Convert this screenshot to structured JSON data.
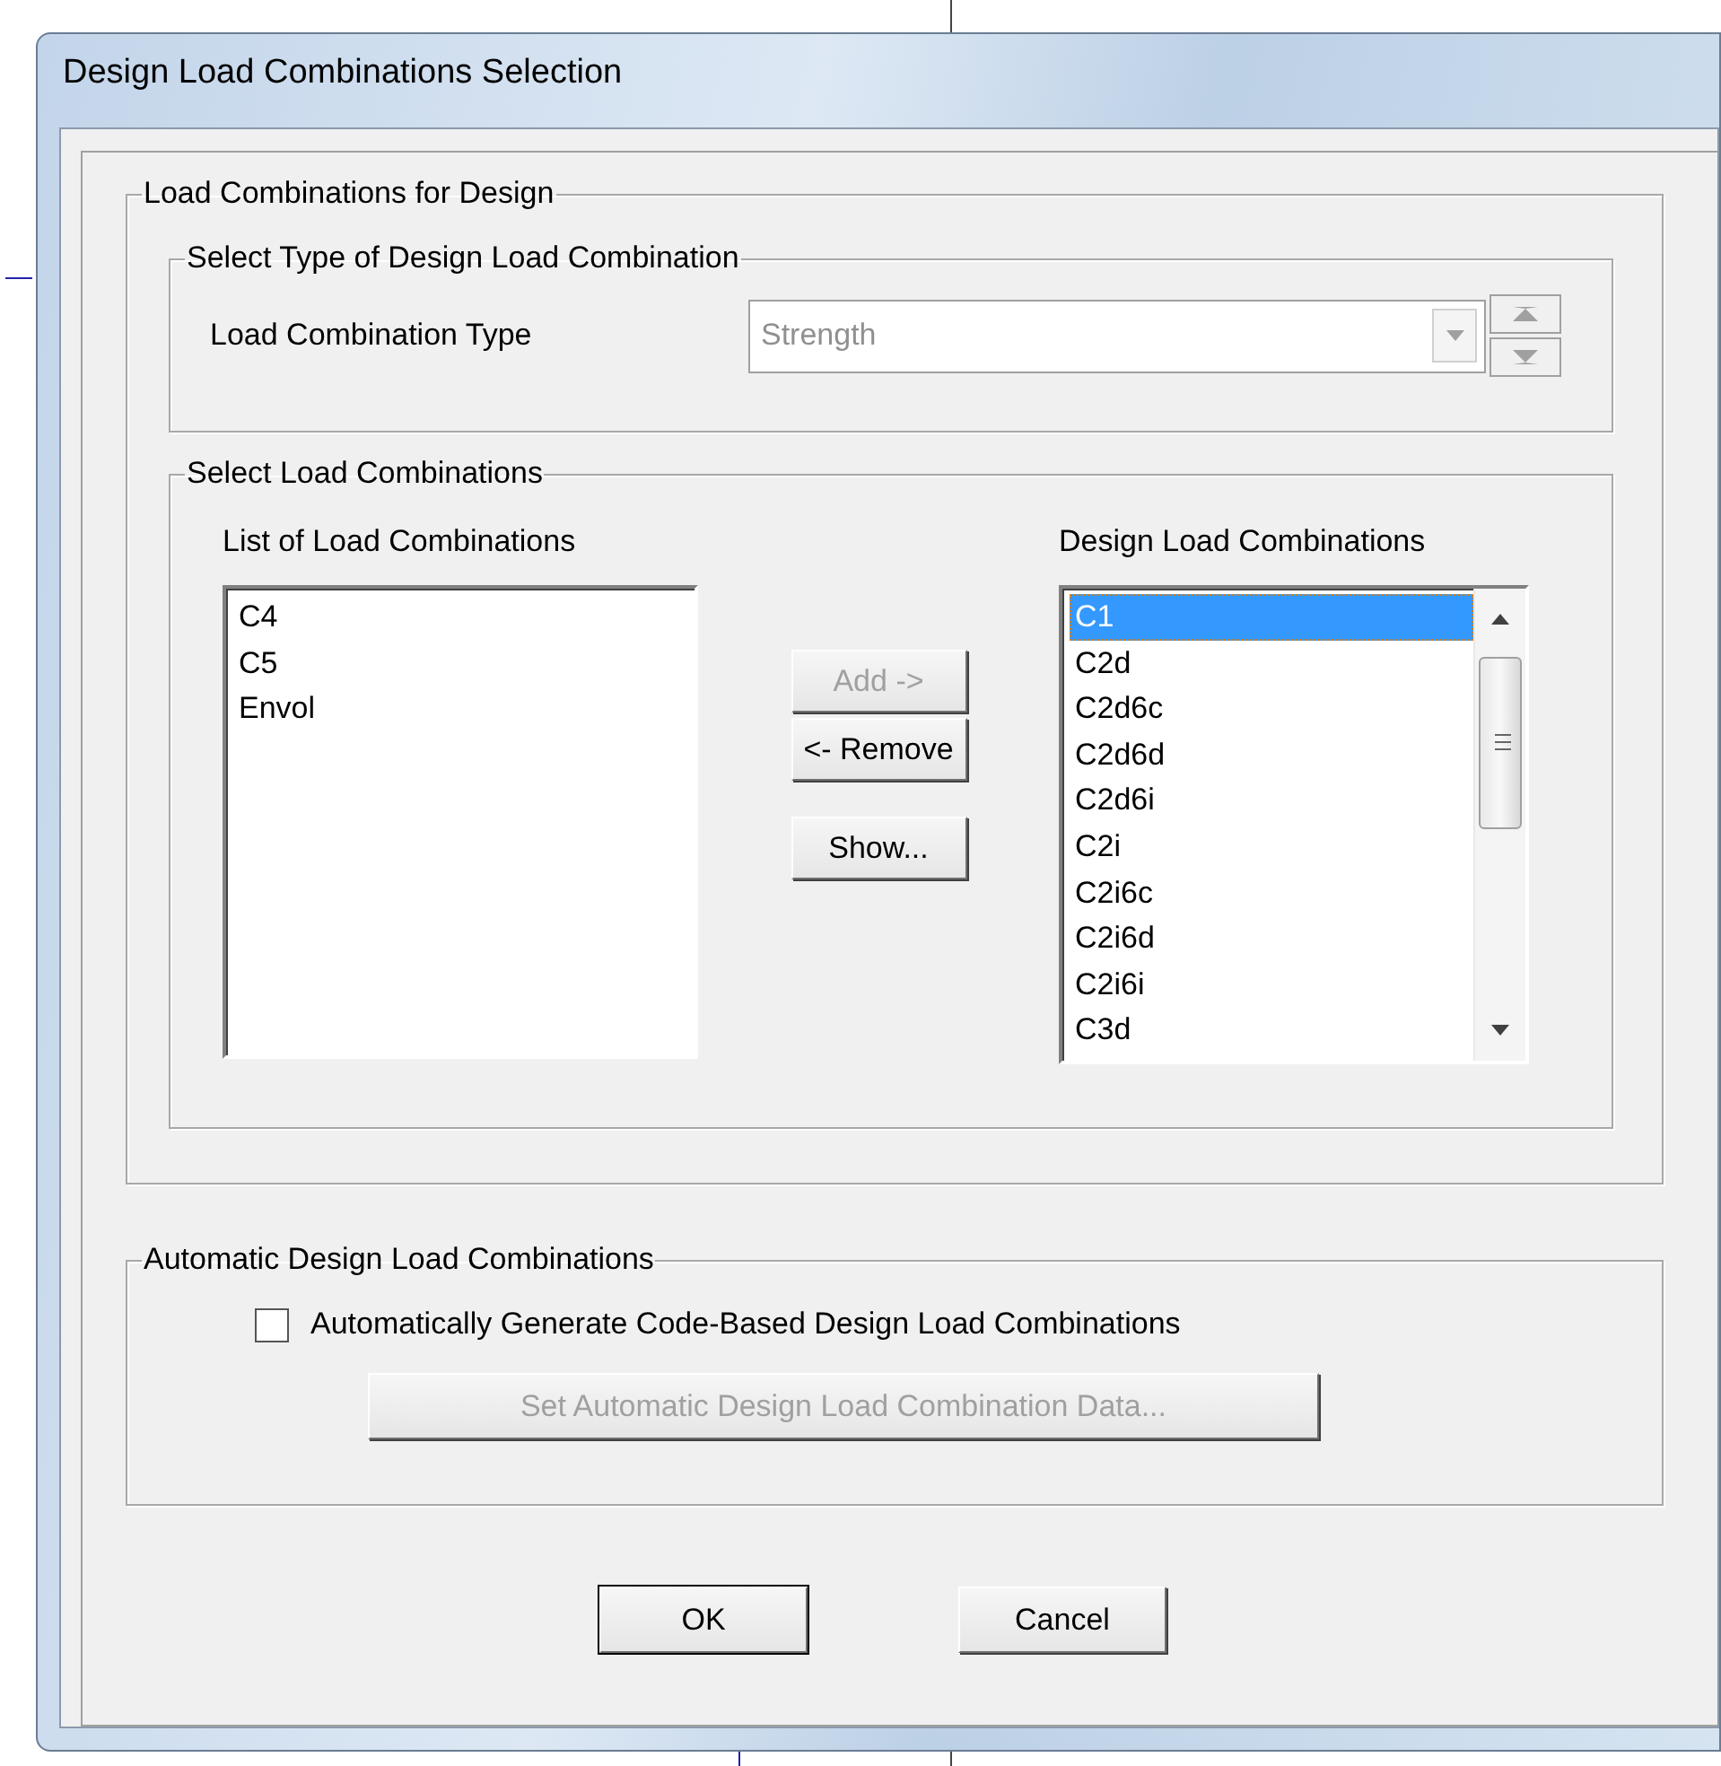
{
  "window": {
    "title": "Design Load Combinations Selection"
  },
  "design_group": {
    "label": "Load Combinations for Design",
    "type_group": {
      "label": "Select Type of Design Load Combination",
      "field_label": "Load Combination Type",
      "dropdown": {
        "value": "Strength",
        "disabled": true
      }
    },
    "select_group": {
      "label": "Select Load Combinations",
      "list_label": "List of Load Combinations",
      "list_items": [
        {
          "label": "C4",
          "selected": false
        },
        {
          "label": "C5",
          "selected": false
        },
        {
          "label": "Envol",
          "selected": false
        }
      ],
      "buttons": [
        {
          "label": "Add ->",
          "disabled": true
        },
        {
          "label": "<- Remove",
          "disabled": false
        },
        {
          "label": "Show...",
          "disabled": false
        }
      ],
      "design_label": "Design Load Combinations",
      "design_items": [
        {
          "label": "C1",
          "selected": true
        },
        {
          "label": "C2d",
          "selected": false
        },
        {
          "label": "C2d6c",
          "selected": false
        },
        {
          "label": "C2d6d",
          "selected": false
        },
        {
          "label": "C2d6i",
          "selected": false
        },
        {
          "label": "C2i",
          "selected": false
        },
        {
          "label": "C2i6c",
          "selected": false
        },
        {
          "label": "C2i6d",
          "selected": false
        },
        {
          "label": "C2i6i",
          "selected": false
        },
        {
          "label": "C3d",
          "selected": false
        }
      ]
    }
  },
  "auto_group": {
    "label": "Automatic Design Load Combinations",
    "checkbox": {
      "label": "Automatically Generate Code-Based Design Load Combinations",
      "checked": false
    },
    "set_button": {
      "label": "Set Automatic Design Load Combination Data...",
      "disabled": true
    }
  },
  "buttons": [
    {
      "label": "OK",
      "default": true
    },
    {
      "label": "Cancel",
      "default": false
    }
  ]
}
